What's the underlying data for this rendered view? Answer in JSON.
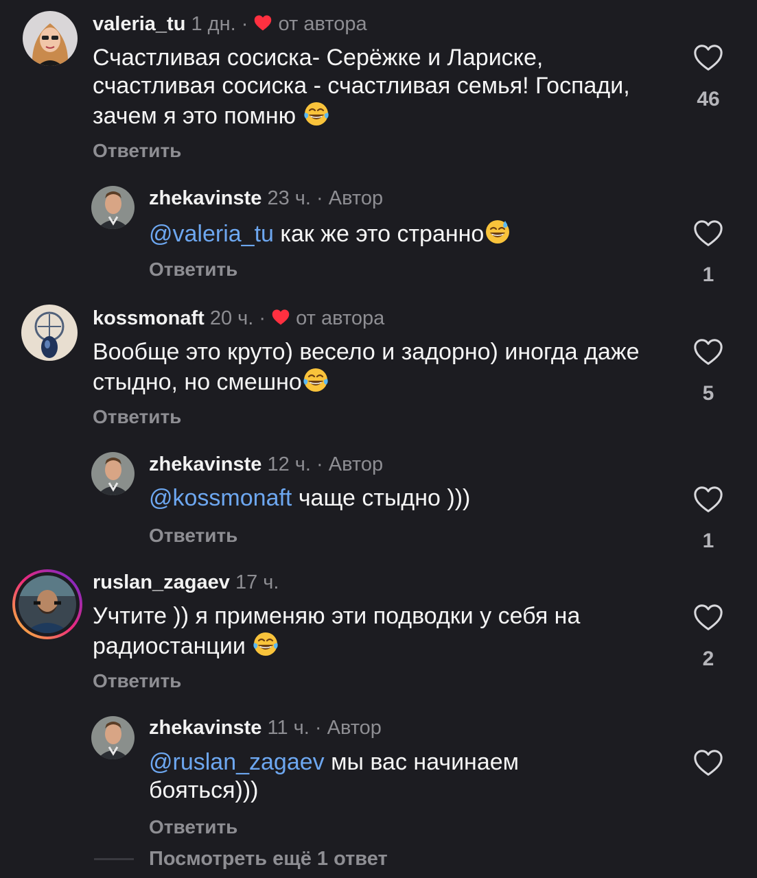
{
  "comments": [
    {
      "username": "valeria_tu",
      "time": "1 дн.",
      "separator": "·",
      "badge": "от автора",
      "text": "Счастливая сосиска- Серёжке и Лариске, счастливая сосиска - счастливая семья! Госпади, зачем я это помню",
      "emoji": "joy-emoji",
      "reply_label": "Ответить",
      "likes": "46"
    },
    {
      "username": "zhekavinste",
      "time": "23 ч.",
      "separator": "·",
      "badge": "Автор",
      "mention": "@valeria_tu",
      "text": " как же это странно",
      "emoji": "sweat-smile-emoji",
      "reply_label": "Ответить",
      "likes": "1"
    },
    {
      "username": "kossmonaft",
      "time": "20 ч.",
      "separator": "·",
      "badge": "от автора",
      "text": "Вообще это круто) весело и задорно) иногда даже стыдно, но смешно",
      "emoji": "joy-emoji",
      "reply_label": "Ответить",
      "likes": "5"
    },
    {
      "username": "zhekavinste",
      "time": "12 ч.",
      "separator": "·",
      "badge": "Автор",
      "mention": "@kossmonaft",
      "text": " чаще стыдно )))",
      "reply_label": "Ответить",
      "likes": "1"
    },
    {
      "username": "ruslan_zagaev",
      "time": "17 ч.",
      "text": "Учтите )) я применяю эти подводки у себя на радиостанции",
      "emoji": "joy-emoji",
      "reply_label": "Ответить",
      "likes": "2"
    },
    {
      "username": "zhekavinste",
      "time": "11 ч.",
      "separator": "·",
      "badge": "Автор",
      "mention": "@ruslan_zagaev",
      "text": " мы вас начинаем бояться)))",
      "reply_label": "Ответить",
      "likes": ""
    }
  ],
  "more_replies": "Посмотреть ещё 1 ответ",
  "colors": {
    "background": "#1c1c21",
    "mention": "#6da7f0",
    "meta": "#8e8e93",
    "heart_red": "#ff3040"
  }
}
